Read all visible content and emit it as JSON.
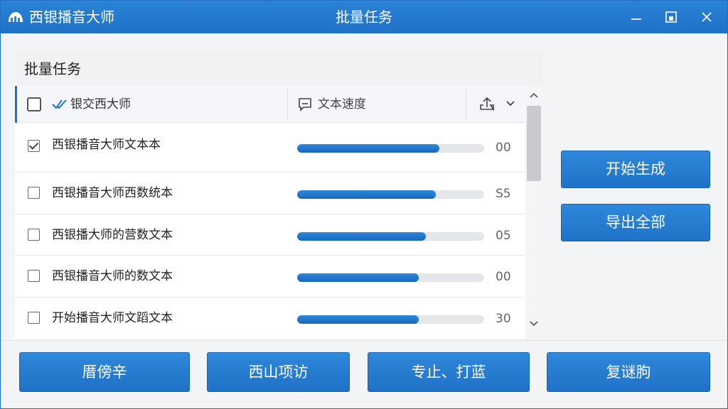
{
  "titlebar": {
    "app_name": "西银播音大师",
    "window_title": "批量任务",
    "logo_icon": "app-logo-icon",
    "minimize_icon": "minimize-icon",
    "maximize_icon": "restore-icon",
    "close_icon": "close-icon"
  },
  "panel": {
    "title": "批量任务",
    "header": {
      "col1_label": "银交西大师",
      "col1_icon": "double-check-icon",
      "col2_label": "文本速度",
      "col2_icon": "comment-edit-icon",
      "col3_icon": "upload-icon",
      "col3_chevron": "chevron-down-icon"
    },
    "rows": [
      {
        "name": "西银播音大师文本本",
        "checked": true,
        "progress": 0.76,
        "value": "00"
      },
      {
        "name": "西银播音大师西数统本",
        "checked": false,
        "progress": 0.74,
        "value": "S5"
      },
      {
        "name": "西银播大师的营数文本",
        "checked": false,
        "progress": 0.69,
        "value": "05"
      },
      {
        "name": "西银播音大师的数文本",
        "checked": false,
        "progress": 0.65,
        "value": "00"
      },
      {
        "name": "开始播音大师文蹈文本",
        "checked": false,
        "progress": 0.65,
        "value": "30"
      }
    ]
  },
  "side_buttons": {
    "start": "开始生成",
    "export_all": "导出全部"
  },
  "bottom_buttons": [
    "厝傍辛",
    "西山项访",
    "专止、打蓝",
    "复谜朐"
  ],
  "colors": {
    "accent": "#1f72c7",
    "track": "#e4e6ea"
  }
}
